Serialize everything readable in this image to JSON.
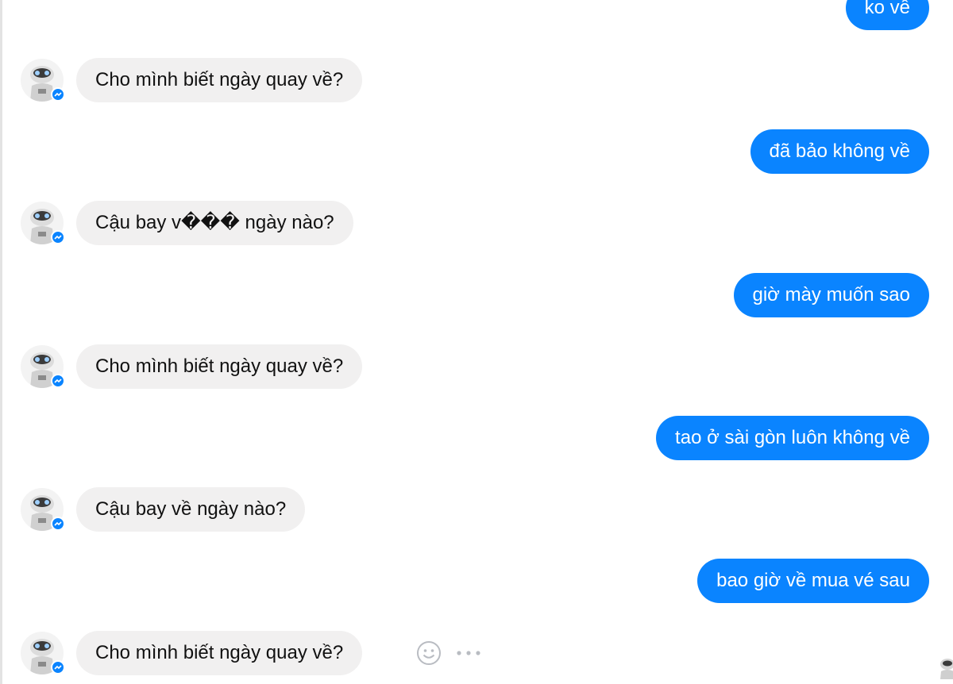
{
  "colors": {
    "outgoing_bubble": "#0a84ff",
    "incoming_bubble": "#f1f0f0",
    "badge": "#0a84ff"
  },
  "icons": {
    "avatar": "robot-avatar-icon",
    "badge": "messenger-badge-icon",
    "react": "smile-icon",
    "more": "more-icon"
  },
  "messages": [
    {
      "sender": "user",
      "text": "ko về"
    },
    {
      "sender": "bot",
      "text": "Cho mình biết ngày quay về?"
    },
    {
      "sender": "user",
      "text": "đã bảo không về"
    },
    {
      "sender": "bot",
      "text": "Cậu bay v��� ngày nào?"
    },
    {
      "sender": "user",
      "text": "giờ mày muốn sao"
    },
    {
      "sender": "bot",
      "text": "Cho mình biết ngày quay về?"
    },
    {
      "sender": "user",
      "text": "tao ở sài gòn luôn không về"
    },
    {
      "sender": "bot",
      "text": "Cậu bay về ngày nào?"
    },
    {
      "sender": "user",
      "text": "bao giờ về mua vé sau"
    },
    {
      "sender": "bot",
      "text": "Cho mình biết ngày quay về?"
    }
  ]
}
